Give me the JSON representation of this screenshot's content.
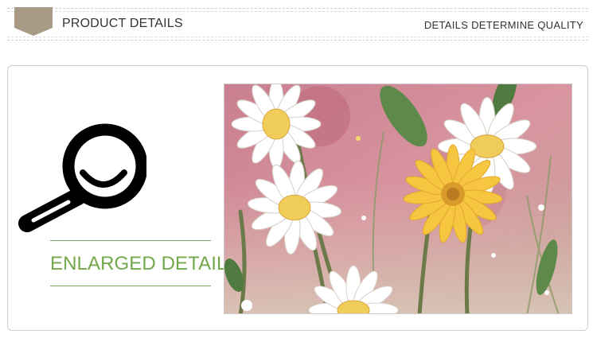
{
  "header": {
    "title": "PRODUCT DETAILS",
    "tagline": "DETAILS DETERMINE QUALITY",
    "badge_color": "#a89a84"
  },
  "detail_panel": {
    "label": "ENLARGED DETAIL",
    "label_color": "#72a84a",
    "rule_color": "#7fa15b",
    "icon": "magnifier-icon"
  },
  "photo": {
    "subject": "watercolor daisies on pink background",
    "colors": {
      "background": "#c98a97",
      "petal": "#ffffff",
      "center": "#f0cc58",
      "yellow_flower": "#f6c640",
      "leaf": "#5d8a4a"
    }
  }
}
